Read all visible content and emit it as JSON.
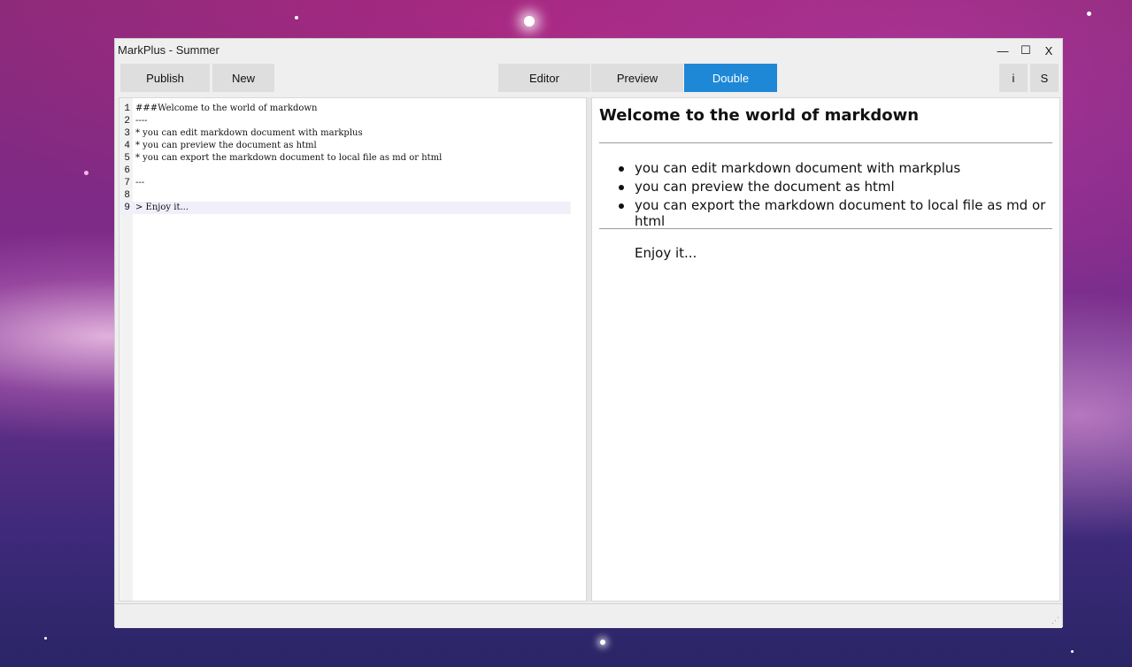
{
  "window": {
    "title": "MarkPlus - Summer",
    "controls": {
      "minimize": "—",
      "maximize": "☐",
      "close": "X"
    }
  },
  "toolbar": {
    "publish_label": "Publish",
    "new_label": "New",
    "editor_label": "Editor",
    "preview_label": "Preview",
    "double_label": "Double",
    "info_label": "i",
    "settings_label": "S",
    "active_mode": "Double",
    "accent_color": "#1e88d6"
  },
  "editor": {
    "lines": [
      {
        "num": "1",
        "text": "###Welcome to the world of markdown"
      },
      {
        "num": "2",
        "text": "----"
      },
      {
        "num": "3",
        "text": "* you can edit markdown document with markplus"
      },
      {
        "num": "4",
        "text": "* you can preview the document as html"
      },
      {
        "num": "5",
        "text": "* you can export the markdown document to local file as md or html"
      },
      {
        "num": "6",
        "text": ""
      },
      {
        "num": "7",
        "text": "---"
      },
      {
        "num": "8",
        "text": ""
      },
      {
        "num": "9",
        "text": "> Enjoy it..."
      }
    ],
    "current_line": "9"
  },
  "preview": {
    "heading": "Welcome to the world of markdown",
    "list_items": [
      "you can edit markdown document with markplus",
      "you can preview the document as html",
      "you can export the markdown document to local file as md or html"
    ],
    "blockquote": "Enjoy it..."
  }
}
